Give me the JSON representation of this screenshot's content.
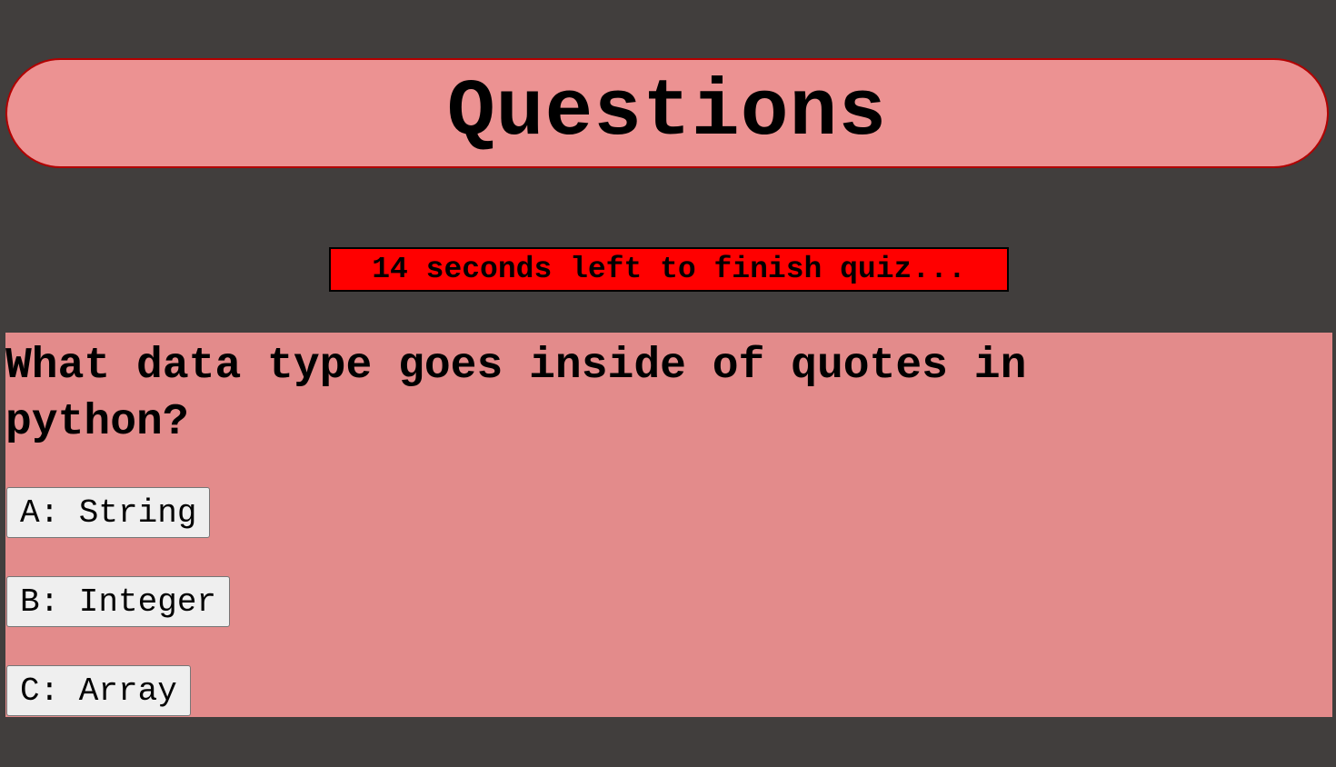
{
  "header": {
    "title": "Questions"
  },
  "timer": {
    "text": "14 seconds left to finish quiz..."
  },
  "quiz": {
    "question": "What data type goes inside of quotes in python?",
    "answers": [
      {
        "label": "A: String"
      },
      {
        "label": "B: Integer"
      },
      {
        "label": "C: Array"
      }
    ]
  },
  "colors": {
    "page_background": "#413e3d",
    "header_background": "#ec9292",
    "header_border": "#b20000",
    "timer_background": "#ff0000",
    "quiz_background": "#e38b8b",
    "button_background": "#efefef"
  }
}
